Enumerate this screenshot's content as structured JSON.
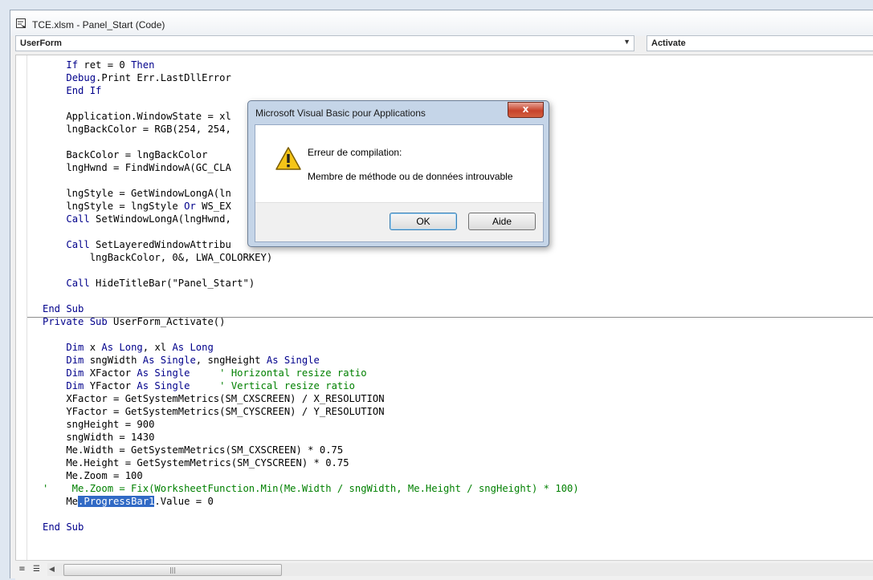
{
  "window": {
    "title": "TCE.xlsm - Panel_Start (Code)"
  },
  "toolbar": {
    "object_combo": "UserForm",
    "procedure_combo": "Activate"
  },
  "code_top": [
    [
      [
        "",
        "    "
      ],
      [
        "kw",
        "If"
      ],
      [
        "",
        " ret = 0 "
      ],
      [
        "kw",
        "Then"
      ]
    ],
    [
      [
        "",
        "    "
      ],
      [
        "kw",
        "Debug"
      ],
      [
        "",
        ".Print Err.LastDllError"
      ]
    ],
    [
      [
        "",
        "    "
      ],
      [
        "kw",
        "End If"
      ]
    ],
    [],
    [
      [
        "",
        "    Application.WindowState = xl"
      ]
    ],
    [
      [
        "",
        "    lngBackColor = RGB(254, 254,"
      ]
    ],
    [],
    [
      [
        "",
        "    BackColor = lngBackColor"
      ]
    ],
    [
      [
        "",
        "    lngHwnd = FindWindowA(GC_CLA"
      ]
    ],
    [],
    [
      [
        "",
        "    lngStyle = GetWindowLongA(ln"
      ]
    ],
    [
      [
        "",
        "    lngStyle = lngStyle "
      ],
      [
        "kw",
        "Or"
      ],
      [
        "",
        " WS_EX"
      ]
    ],
    [
      [
        "",
        "    "
      ],
      [
        "kw",
        "Call"
      ],
      [
        "",
        " SetWindowLongA(lngHwnd,"
      ]
    ],
    [],
    [
      [
        "",
        "    "
      ],
      [
        "kw",
        "Call"
      ],
      [
        "",
        " SetLayeredWindowAttribu"
      ]
    ],
    [
      [
        "",
        "        lngBackColor, 0&, LWA_COLORKEY)"
      ]
    ],
    [],
    [
      [
        "",
        "    "
      ],
      [
        "kw",
        "Call"
      ],
      [
        "",
        " HideTitleBar(\"Panel_Start\")"
      ]
    ],
    [],
    [
      [
        "kw",
        "End Sub"
      ]
    ]
  ],
  "code_bottom": [
    [
      [
        "kw",
        "Private Sub"
      ],
      [
        "",
        " UserForm_Activate()"
      ]
    ],
    [],
    [
      [
        "",
        "    "
      ],
      [
        "kw",
        "Dim"
      ],
      [
        "",
        " x "
      ],
      [
        "kw",
        "As Long"
      ],
      [
        "",
        ", xl "
      ],
      [
        "kw",
        "As Long"
      ]
    ],
    [
      [
        "",
        "    "
      ],
      [
        "kw",
        "Dim"
      ],
      [
        "",
        " sngWidth "
      ],
      [
        "kw",
        "As Single"
      ],
      [
        "",
        ", sngHeight "
      ],
      [
        "kw",
        "As Single"
      ]
    ],
    [
      [
        "",
        "    "
      ],
      [
        "kw",
        "Dim"
      ],
      [
        "",
        " XFactor "
      ],
      [
        "kw",
        "As Single"
      ],
      [
        "",
        "     "
      ],
      [
        "cm",
        "' Horizontal resize ratio"
      ]
    ],
    [
      [
        "",
        "    "
      ],
      [
        "kw",
        "Dim"
      ],
      [
        "",
        " YFactor "
      ],
      [
        "kw",
        "As Single"
      ],
      [
        "",
        "     "
      ],
      [
        "cm",
        "' Vertical resize ratio"
      ]
    ],
    [
      [
        "",
        "    XFactor = GetSystemMetrics(SM_CXSCREEN) / X_RESOLUTION"
      ]
    ],
    [
      [
        "",
        "    YFactor = GetSystemMetrics(SM_CYSCREEN) / Y_RESOLUTION"
      ]
    ],
    [
      [
        "",
        "    sngHeight = 900"
      ]
    ],
    [
      [
        "",
        "    sngWidth = 1430"
      ]
    ],
    [
      [
        "",
        "    Me.Width = GetSystemMetrics(SM_CXSCREEN) * 0.75"
      ]
    ],
    [
      [
        "",
        "    Me.Height = GetSystemMetrics(SM_CYSCREEN) * 0.75"
      ]
    ],
    [
      [
        "",
        "    Me.Zoom = 100"
      ]
    ],
    [
      [
        "cm",
        "'    Me.Zoom = Fix(WorksheetFunction.Min(Me.Width / sngWidth, Me.Height / sngHeight) * 100)"
      ]
    ],
    [
      [
        "",
        "    Me"
      ],
      [
        "sel",
        ".ProgressBar1"
      ],
      [
        "",
        ".Value = 0"
      ]
    ],
    [],
    [
      [
        "kw",
        "End Sub"
      ]
    ]
  ],
  "dialog": {
    "title": "Microsoft Visual Basic pour Applications",
    "close_label": "x",
    "heading": "Erreur de compilation:",
    "message": "Membre de méthode ou de données introuvable",
    "ok_label": "OK",
    "help_label": "Aide"
  },
  "scrollbar": {
    "thumb_grip": "|||"
  }
}
